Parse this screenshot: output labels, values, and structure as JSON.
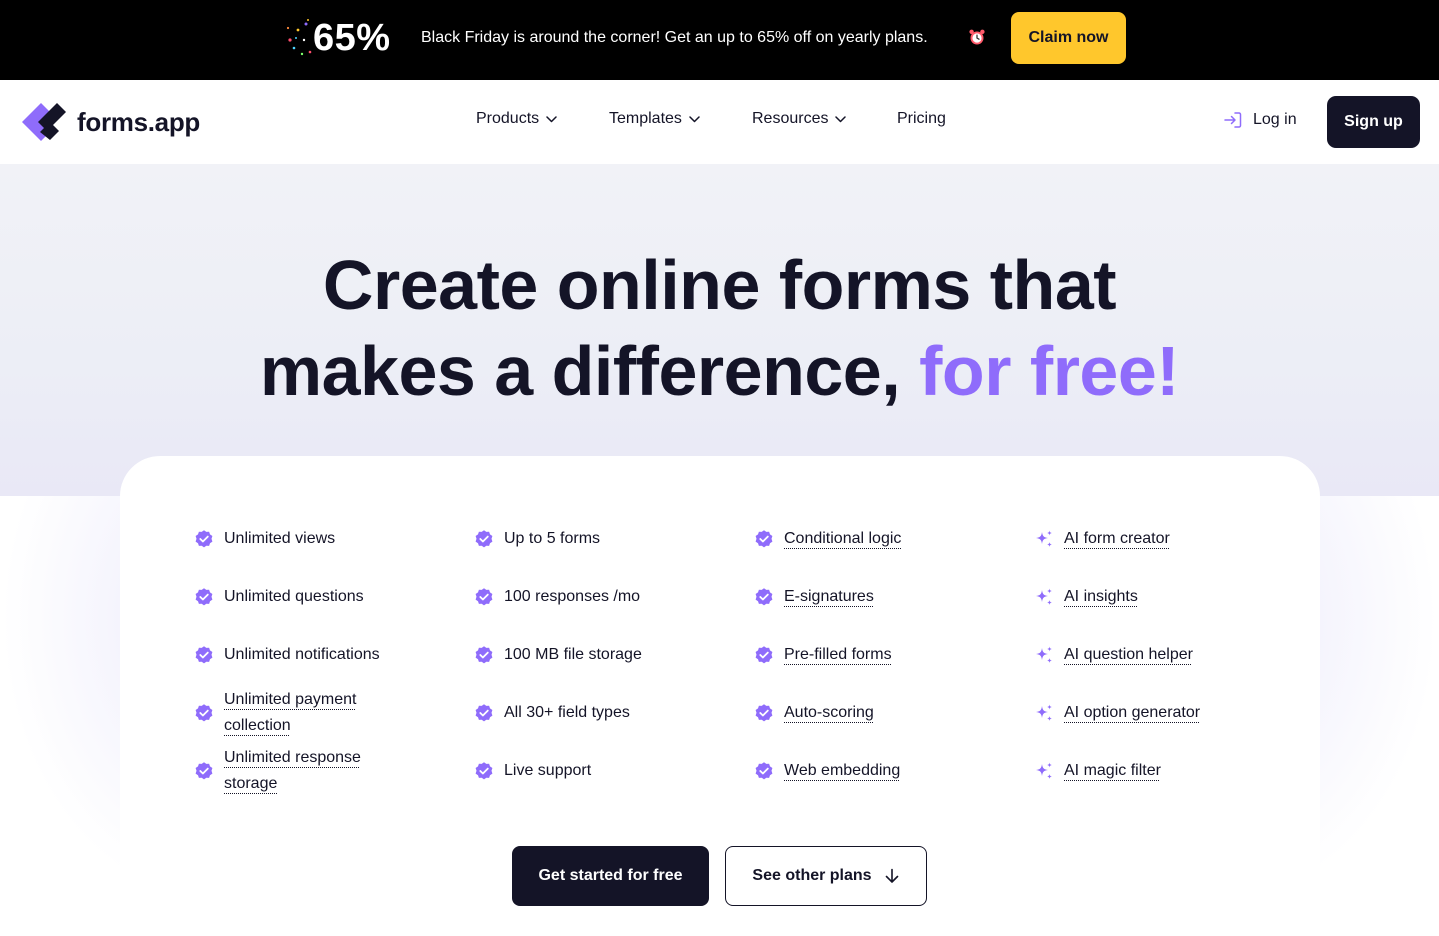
{
  "promo": {
    "percent": "65%",
    "message": "Black Friday is around the corner! Get an up to 65% off on yearly plans.",
    "cta_label": "Claim now",
    "icons": [
      "confetti-icon",
      "alarm-clock-icon"
    ]
  },
  "header": {
    "logo_text": "forms.app",
    "nav": [
      {
        "label": "Products",
        "has_dropdown": true
      },
      {
        "label": "Templates",
        "has_dropdown": true
      },
      {
        "label": "Resources",
        "has_dropdown": true
      },
      {
        "label": "Pricing",
        "has_dropdown": false
      }
    ],
    "login_label": "Log in",
    "signup_label": "Sign up"
  },
  "hero": {
    "title_line1": "Create online forms that",
    "title_line2": "makes a difference,",
    "title_accent": "for free!"
  },
  "features": {
    "columns": [
      {
        "icon": "verified-check-icon",
        "items": [
          {
            "label": "Unlimited views",
            "dotted": false
          },
          {
            "label": "Unlimited questions",
            "dotted": false
          },
          {
            "label": "Unlimited notifications",
            "dotted": false
          },
          {
            "label": "Unlimited payment collection",
            "dotted": true
          },
          {
            "label": "Unlimited response storage",
            "dotted": true
          }
        ]
      },
      {
        "icon": "verified-check-icon",
        "items": [
          {
            "label": "Up to 5 forms",
            "dotted": false
          },
          {
            "label": "100 responses /mo",
            "dotted": false
          },
          {
            "label": "100 MB file storage",
            "dotted": false
          },
          {
            "label": "All 30+ field types",
            "dotted": false
          },
          {
            "label": "Live support",
            "dotted": false
          }
        ]
      },
      {
        "icon": "verified-check-icon",
        "items": [
          {
            "label": "Conditional logic",
            "dotted": true
          },
          {
            "label": "E-signatures",
            "dotted": true
          },
          {
            "label": "Pre-filled forms",
            "dotted": true
          },
          {
            "label": "Auto-scoring",
            "dotted": true
          },
          {
            "label": "Web embedding",
            "dotted": true
          }
        ]
      },
      {
        "icon": "ai-sparkle-icon",
        "items": [
          {
            "label": "AI form creator",
            "dotted": true
          },
          {
            "label": "AI insights",
            "dotted": true
          },
          {
            "label": "AI question helper",
            "dotted": true
          },
          {
            "label": "AI option generator",
            "dotted": true
          },
          {
            "label": "AI magic filter",
            "dotted": true
          }
        ]
      }
    ]
  },
  "actions": {
    "primary_label": "Get started for free",
    "secondary_label": "See other plans"
  },
  "colors": {
    "brand_dark": "#141427",
    "accent_purple": "#8f6cfb",
    "promo_yellow": "#ffc72c",
    "promo_bg": "#000000"
  }
}
